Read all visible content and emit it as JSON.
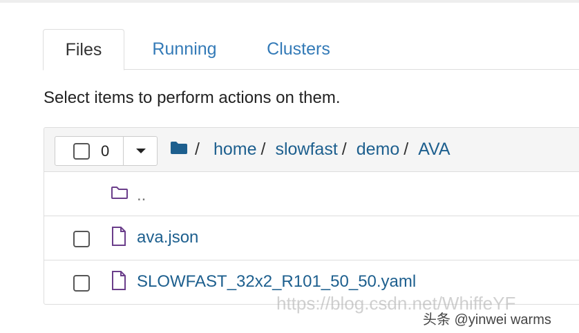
{
  "tabs": [
    {
      "label": "Files",
      "active": true
    },
    {
      "label": "Running",
      "active": false
    },
    {
      "label": "Clusters",
      "active": false
    }
  ],
  "hint": "Select items to perform actions on them.",
  "selection": {
    "count": "0"
  },
  "breadcrumb": {
    "separator": "/",
    "items": [
      "home",
      "slowfast",
      "demo",
      "AVA"
    ]
  },
  "files": [
    {
      "name": "..",
      "type": "folder"
    },
    {
      "name": "ava.json",
      "type": "file"
    },
    {
      "name": "SLOWFAST_32x2_R101_50_50.yaml",
      "type": "file"
    }
  ],
  "watermark": {
    "url": "https://blog.csdn.net/WhiffeYF",
    "credit": "头条 @yinwei warms"
  },
  "colors": {
    "link": "#1d5f8e",
    "folder_icon": "#1d5f8e",
    "up_folder": "#6a3d8a",
    "border": "#dddddd"
  }
}
